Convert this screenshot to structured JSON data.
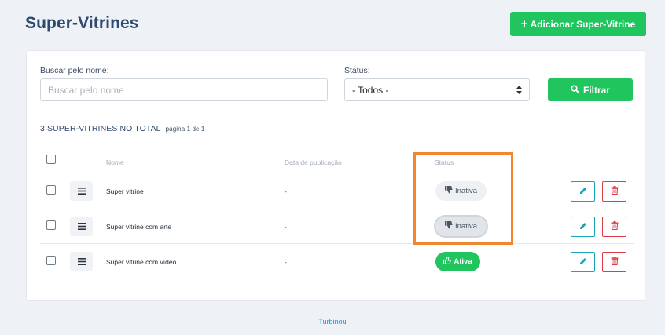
{
  "page": {
    "title": "Super-Vitrines",
    "add_button": "Adicionar Super-Vitrine"
  },
  "filters": {
    "search_label": "Buscar pelo nome:",
    "search_placeholder": "Buscar pelo nome",
    "status_label": "Status:",
    "status_selected": "- Todos -",
    "filter_button": "Filtrar"
  },
  "summary": {
    "total": "3 SUPER-VITRINES NO TOTAL",
    "pagination": "página 1 de 1"
  },
  "table": {
    "columns": [
      "Nome",
      "Data de publicação",
      "Status"
    ],
    "rows": [
      {
        "name": "Super vitrine",
        "date": "-",
        "status": "Inativa",
        "status_type": "inactive"
      },
      {
        "name": "Super vitrine com arte",
        "date": "-",
        "status": "Inativa",
        "status_type": "inactive"
      },
      {
        "name": "Super vitrine com vídeo",
        "date": "-",
        "status": "Ativa",
        "status_type": "active"
      }
    ]
  },
  "footer": {
    "brand": "Turbinou"
  },
  "colors": {
    "accent_green": "#21c55d",
    "edit_teal": "#1aa3b8",
    "delete_red": "#dc3c46",
    "highlight_orange": "#f0862e",
    "title_navy": "#2e4a6e"
  },
  "icons": {
    "add": "plus-icon",
    "filter": "search-icon",
    "row_drag": "menu-icon",
    "inactive": "thumbs-down-icon",
    "active": "thumbs-up-icon",
    "edit": "pencil-icon",
    "delete": "trash-icon"
  }
}
